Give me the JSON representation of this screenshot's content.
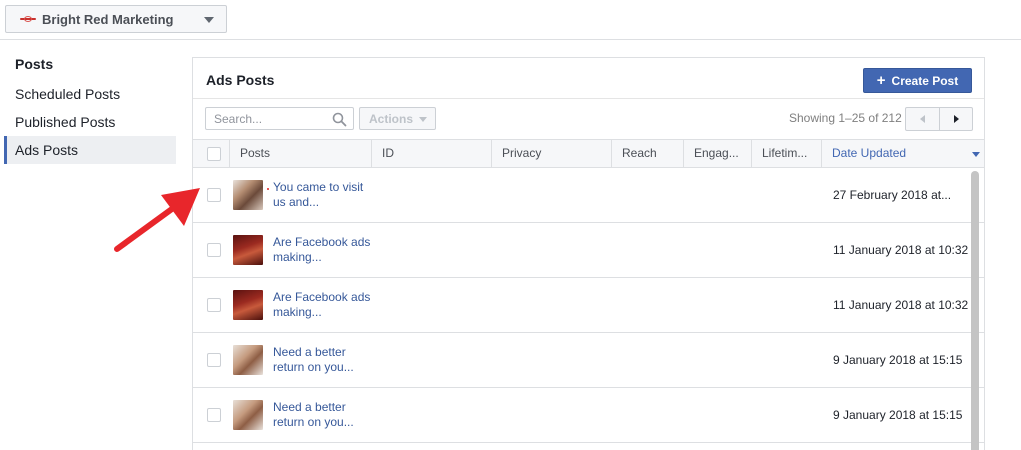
{
  "page_selector": {
    "name": "Bright Red Marketing"
  },
  "sidebar": {
    "heading": "Posts",
    "items": [
      {
        "label": "Scheduled Posts"
      },
      {
        "label": "Published Posts"
      },
      {
        "label": "Ads Posts"
      }
    ]
  },
  "panel": {
    "title": "Ads Posts",
    "create_label": "Create Post",
    "search_placeholder": "Search...",
    "actions_label": "Actions",
    "showing": "Showing 1–25 of 212"
  },
  "table": {
    "headers": [
      "Posts",
      "ID",
      "Privacy",
      "Reach",
      "Engag...",
      "Lifetim...",
      "Date Updated"
    ],
    "rows": [
      {
        "text": "You came to visit us and...",
        "date": "27 February 2018 at..."
      },
      {
        "text": "Are Facebook ads making...",
        "date": "11 January 2018 at 10:32"
      },
      {
        "text": "Are Facebook ads making...",
        "date": "11 January 2018 at 10:32"
      },
      {
        "text": "Need a better return on you...",
        "date": "9 January 2018 at 15:15"
      },
      {
        "text": "Need a better return on you...",
        "date": "9 January 2018 at 15:15"
      }
    ]
  },
  "colors": {
    "accent": "#4267b2",
    "link": "#365899",
    "annotation_arrow": "#e8262b"
  },
  "icons": [
    "search-icon",
    "plus-icon",
    "chevron-down-icon",
    "pager-prev-icon",
    "pager-next-icon",
    "sort-desc-icon",
    "annotation-arrow"
  ]
}
